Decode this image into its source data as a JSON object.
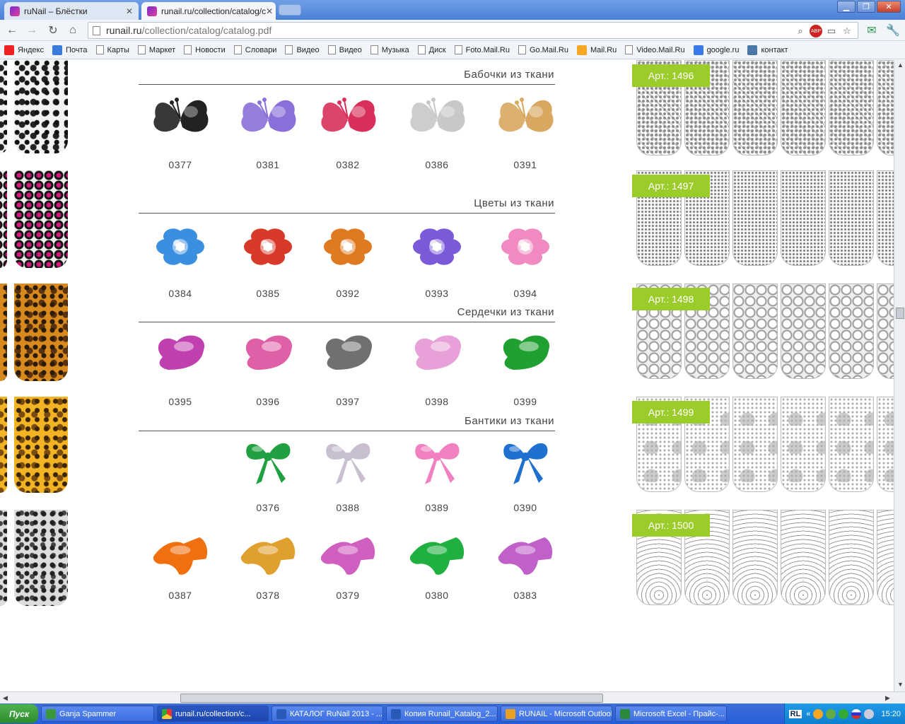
{
  "browser": {
    "tabs": [
      {
        "title": "ruNail – Блёстки"
      },
      {
        "title": "runail.ru/collection/catalog/c"
      }
    ],
    "url_host": "runail.ru",
    "url_path": "/collection/catalog/catalog.pdf",
    "bookmarks": [
      "Яндекс",
      "Почта",
      "Карты",
      "Маркет",
      "Новости",
      "Словари",
      "Видео",
      "Видео",
      "Музыка",
      "Диск",
      "Foto.Mail.Ru",
      "Go.Mail.Ru",
      "Mail.Ru",
      "Video.Mail.Ru",
      "google.ru",
      "контакт"
    ]
  },
  "catalog": {
    "sections": [
      {
        "title": "Бабочки из ткани",
        "items": [
          "0377",
          "0381",
          "0382",
          "0386",
          "0391"
        ],
        "colors": [
          "#222222",
          "#8a6fd8",
          "#d8305a",
          "#c8c8c8",
          "#d8a860"
        ]
      },
      {
        "title": "Цветы из ткани",
        "items": [
          "0384",
          "0385",
          "0392",
          "0393",
          "0394"
        ],
        "colors": [
          "#3a8fe0",
          "#d83a2a",
          "#e07a20",
          "#7a5ad8",
          "#f08ac0"
        ]
      },
      {
        "title": "Сердечки из ткани",
        "items": [
          "0395",
          "0396",
          "0397",
          "0398",
          "0399"
        ],
        "colors": [
          "#c040b0",
          "#e060a8",
          "#707070",
          "#e8a0d8",
          "#20a030"
        ]
      },
      {
        "title": "Бантики из ткани",
        "items": [
          "0376",
          "0388",
          "0389",
          "0390"
        ],
        "colors": [
          "#20a040",
          "#c8c0d0",
          "#f080c0",
          "#2070d0"
        ]
      }
    ],
    "extra_row": {
      "items": [
        "0387",
        "0378",
        "0379",
        "0380",
        "0383"
      ],
      "colors": [
        "#f07010",
        "#e0a030",
        "#d060c0",
        "#20b040",
        "#c060c8"
      ]
    },
    "articles": [
      "Арт.: 1496",
      "Арт.: 1497",
      "Арт.: 1498",
      "Арт.: 1499",
      "Арт.: 1500"
    ]
  },
  "taskbar": {
    "start": "Пуск",
    "items": [
      "Ganja Spammer",
      "runail.ru/collection/c...",
      "КАТАЛОГ RuNail 2013 - ...",
      "Копия Runail_Katalog_2...",
      "RUNAIL - Microsoft Outlook",
      "Microsoft Excel - Прайс-..."
    ],
    "lang": "RL",
    "clock": "15:20"
  }
}
